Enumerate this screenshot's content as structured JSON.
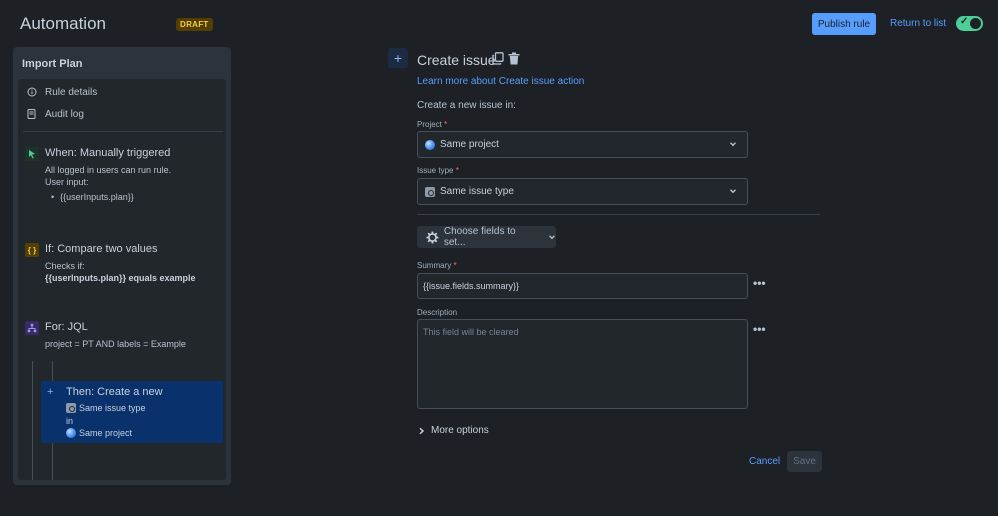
{
  "header": {
    "app_title": "Automation",
    "draft_badge": "DRAFT",
    "publish_label": "Publish rule",
    "return_label": "Return to list",
    "toggle_on": true
  },
  "sidebar": {
    "title": "Import Plan",
    "nav": [
      {
        "label": "Rule details",
        "icon": "info-icon"
      },
      {
        "label": "Audit log",
        "icon": "document-icon"
      }
    ],
    "trigger": {
      "title": "When: Manually triggered",
      "line1": "All logged in users can run rule.",
      "line2": "User input:",
      "bullet": "{{userInputs.plan}}",
      "icon_color": "#4bce97"
    },
    "condition": {
      "title": "If: Compare two values",
      "line1": "Checks if:",
      "line2": "{{userInputs.plan}} equals example",
      "icon_text": "{ }",
      "icon_color": "#f5cd47"
    },
    "branch": {
      "title": "For: JQL",
      "line1": "project = PT AND labels = Example",
      "icon_color": "#9f8fef"
    },
    "action": {
      "plus": "+",
      "title": "Then: Create a new",
      "issue_type": "Same issue type",
      "in_label": "in",
      "project": "Same project"
    }
  },
  "main": {
    "add_label": "+",
    "title": "Create issue",
    "learn_link": "Learn more about Create issue action",
    "create_in": "Create a new issue in:",
    "project": {
      "label": "Project",
      "required": "*",
      "value": "Same project"
    },
    "issue_type": {
      "label": "Issue type",
      "required": "*",
      "value": "Same issue type"
    },
    "choose_fields": "Choose fields to set...",
    "summary": {
      "label": "Summary",
      "required": "*",
      "value": "{{issue.fields.summary}}"
    },
    "description": {
      "label": "Description",
      "placeholder": "This field will be cleared"
    },
    "more_options": "More options",
    "cancel_label": "Cancel",
    "save_label": "Save"
  },
  "colors": {
    "background": "#1d2125",
    "accent": "#579dff",
    "toggle": "#4bce97"
  }
}
